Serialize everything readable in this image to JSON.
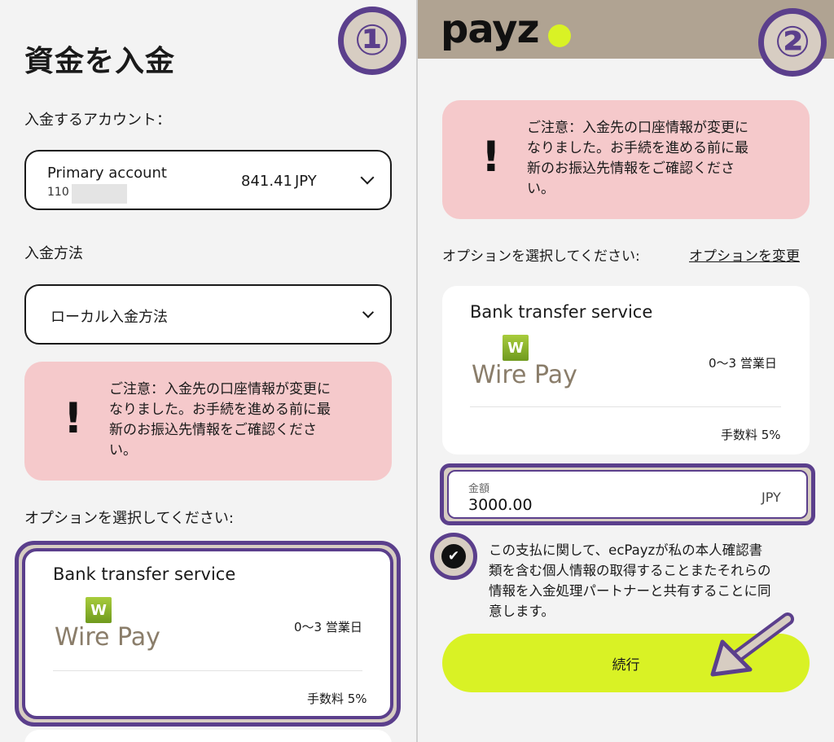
{
  "left": {
    "badge": "①",
    "title": "資金を入金",
    "account_label": "入金するアカウント：",
    "account": {
      "name": "Primary account",
      "number": "110",
      "balance": "841.41",
      "currency": "JPY"
    },
    "method_label": "入金方法",
    "method_value": "ローカル入金方法",
    "notice": {
      "icon": "!",
      "lines": [
        "ご注意：入金先の口座情報が変更に",
        "なりました。お手続を進める前に最",
        "新のお振込先情報をご確認くださ",
        "い。"
      ]
    },
    "options_label": "オプションを選択してください:",
    "card": {
      "title": "Bank transfer service",
      "logo_letter": "W",
      "logo_text": "Wire Pay",
      "days": "0〜3 営業日",
      "fee": "手数料 5%"
    }
  },
  "right": {
    "badge": "②",
    "logo": "payz",
    "notice": {
      "icon": "!",
      "lines": [
        "ご注意：入金先の口座情報が変更に",
        "なりました。お手続を進める前に最",
        "新のお振込先情報をご確認くださ",
        "い。"
      ]
    },
    "options_label": "オプションを選択してください:",
    "options_change": "オプションを変更",
    "card": {
      "title": "Bank transfer service",
      "logo_letter": "W",
      "logo_text": "Wire Pay",
      "days": "0〜3 営業日",
      "fee": "手数料 5%"
    },
    "amount": {
      "label": "金額",
      "value": "3000.00",
      "currency": "JPY"
    },
    "consent_lines": [
      "この支払に関して、ecPayzが私の本人確認書",
      "類を含む個人情報の取得することまたそれらの",
      "情報を入金処理パートナーと共有することに同",
      "意します。"
    ],
    "continue_label": "続行"
  },
  "colors": {
    "accent": "#5b3f8c",
    "brand_lime": "#d9f225",
    "notice_bg": "#f5c9cb",
    "header_bg": "#b0a392"
  }
}
